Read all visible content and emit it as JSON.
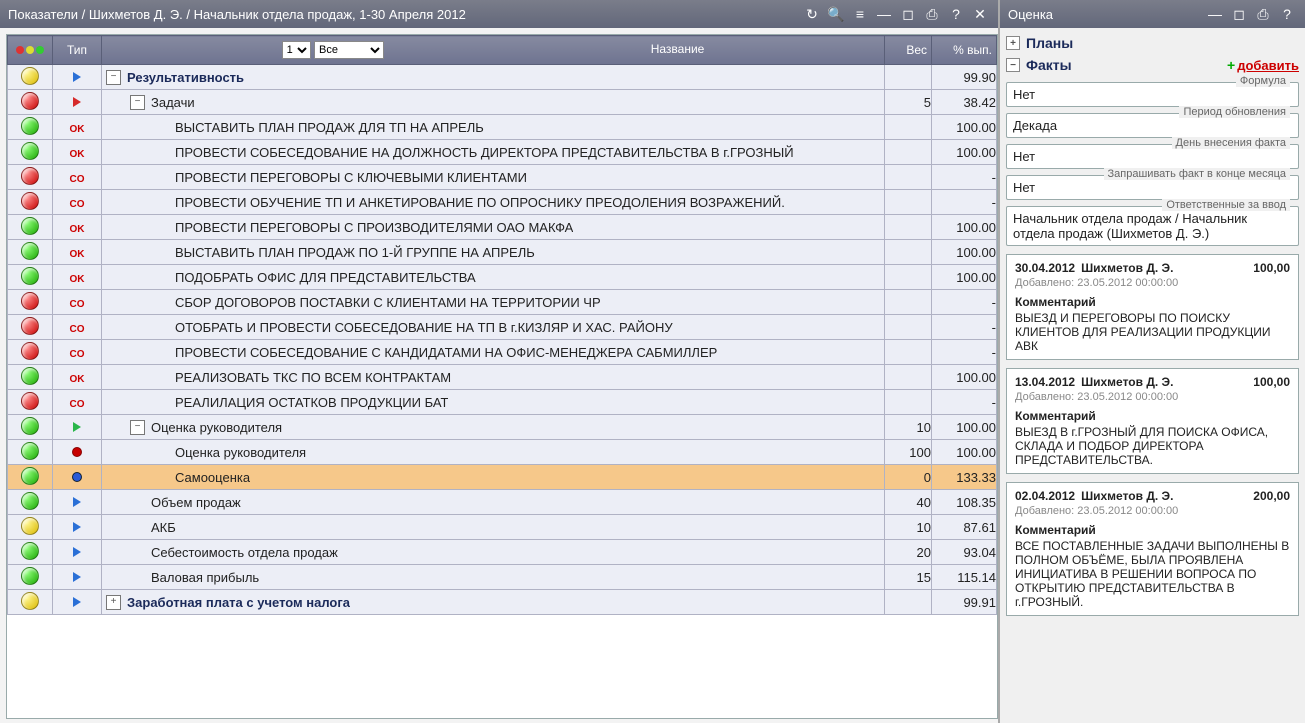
{
  "left": {
    "title": "Показатели / Шихметов Д. Э. / Начальник отдела продаж, 1-30 Апреля 2012",
    "select_level": "1",
    "select_filter": "Все",
    "cols": {
      "name": "Название",
      "type": "Тип",
      "weight": "Вес",
      "pct": "% вып."
    },
    "rows": [
      {
        "status": "yellow",
        "type": "tri-blue",
        "indent": 0,
        "tree": "-",
        "label": "Результативность",
        "bold": true,
        "weight": "",
        "pct": "99.90"
      },
      {
        "status": "red",
        "type": "tri-red",
        "indent": 1,
        "tree": "-",
        "label": "Задачи",
        "bold": false,
        "weight": "5",
        "pct": "38.42"
      },
      {
        "status": "green",
        "type": "OK",
        "indent": 2,
        "tree": "",
        "label": "ВЫСТАВИТЬ ПЛАН ПРОДАЖ ДЛЯ ТП НА АПРЕЛЬ",
        "bold": false,
        "weight": "",
        "pct": "100.00"
      },
      {
        "status": "green",
        "type": "OK",
        "indent": 2,
        "tree": "",
        "label": "ПРОВЕСТИ СОБЕСЕДОВАНИЕ НА ДОЛЖНОСТЬ ДИРЕКТОРА ПРЕДСТАВИТЕЛЬСТВА В г.ГРОЗНЫЙ",
        "bold": false,
        "weight": "",
        "pct": "100.00"
      },
      {
        "status": "red",
        "type": "CO",
        "indent": 2,
        "tree": "",
        "label": "ПРОВЕСТИ ПЕРЕГОВОРЫ С КЛЮЧЕВЫМИ КЛИЕНТАМИ",
        "bold": false,
        "weight": "",
        "pct": "-"
      },
      {
        "status": "red",
        "type": "CO",
        "indent": 2,
        "tree": "",
        "label": "ПРОВЕСТИ ОБУЧЕНИЕ ТП И АНКЕТИРОВАНИЕ ПО ОПРОСНИКУ ПРЕОДОЛЕНИЯ ВОЗРАЖЕНИЙ.",
        "bold": false,
        "weight": "",
        "pct": "-"
      },
      {
        "status": "green",
        "type": "OK",
        "indent": 2,
        "tree": "",
        "label": "ПРОВЕСТИ ПЕРЕГОВОРЫ С ПРОИЗВОДИТЕЛЯМИ ОАО МАКФА",
        "bold": false,
        "weight": "",
        "pct": "100.00"
      },
      {
        "status": "green",
        "type": "OK",
        "indent": 2,
        "tree": "",
        "label": "ВЫСТАВИТЬ ПЛАН ПРОДАЖ ПО 1-Й ГРУППЕ НА АПРЕЛЬ",
        "bold": false,
        "weight": "",
        "pct": "100.00"
      },
      {
        "status": "green",
        "type": "OK",
        "indent": 2,
        "tree": "",
        "label": "ПОДОБРАТЬ ОФИС ДЛЯ ПРЕДСТАВИТЕЛЬСТВА",
        "bold": false,
        "weight": "",
        "pct": "100.00"
      },
      {
        "status": "red",
        "type": "CO",
        "indent": 2,
        "tree": "",
        "label": "СБОР ДОГОВОРОВ ПОСТАВКИ С КЛИЕНТАМИ НА ТЕРРИТОРИИ ЧР",
        "bold": false,
        "weight": "",
        "pct": "-"
      },
      {
        "status": "red",
        "type": "CO",
        "indent": 2,
        "tree": "",
        "label": "ОТОБРАТЬ И ПРОВЕСТИ СОБЕСЕДОВАНИЕ НА ТП В г.КИЗЛЯР И ХАС. РАЙОНУ",
        "bold": false,
        "weight": "",
        "pct": "-"
      },
      {
        "status": "red",
        "type": "CO",
        "indent": 2,
        "tree": "",
        "label": "ПРОВЕСТИ СОБЕСЕДОВАНИЕ С КАНДИДАТАМИ НА ОФИС-МЕНЕДЖЕРА САБМИЛЛЕР",
        "bold": false,
        "weight": "",
        "pct": "-"
      },
      {
        "status": "green",
        "type": "OK",
        "indent": 2,
        "tree": "",
        "label": "РЕАЛИЗОВАТЬ ТКС ПО ВСЕМ КОНТРАКТАМ",
        "bold": false,
        "weight": "",
        "pct": "100.00"
      },
      {
        "status": "red",
        "type": "CO",
        "indent": 2,
        "tree": "",
        "label": "РЕАЛИЛАЦИЯ ОСТАТКОВ ПРОДУКЦИИ БАТ",
        "bold": false,
        "weight": "",
        "pct": "-"
      },
      {
        "status": "green",
        "type": "tri-green",
        "indent": 1,
        "tree": "-",
        "label": "Оценка руководителя",
        "bold": false,
        "weight": "10",
        "pct": "100.00"
      },
      {
        "status": "green",
        "type": "dot-red",
        "indent": 2,
        "tree": "",
        "label": "Оценка руководителя",
        "bold": false,
        "weight": "100",
        "pct": "100.00"
      },
      {
        "status": "green",
        "type": "dot-blue",
        "indent": 2,
        "tree": "",
        "label": "Самооценка",
        "bold": false,
        "weight": "0",
        "pct": "133.33",
        "selected": true
      },
      {
        "status": "green",
        "type": "tri-blue",
        "indent": 1,
        "tree": "",
        "label": "Объем продаж",
        "bold": false,
        "weight": "40",
        "pct": "108.35"
      },
      {
        "status": "yellow",
        "type": "tri-blue",
        "indent": 1,
        "tree": "",
        "label": "АКБ",
        "bold": false,
        "weight": "10",
        "pct": "87.61"
      },
      {
        "status": "green",
        "type": "tri-blue",
        "indent": 1,
        "tree": "",
        "label": "Себестоимость отдела продаж",
        "bold": false,
        "weight": "20",
        "pct": "93.04"
      },
      {
        "status": "green",
        "type": "tri-blue",
        "indent": 1,
        "tree": "",
        "label": "Валовая прибыль",
        "bold": false,
        "weight": "15",
        "pct": "115.14"
      },
      {
        "status": "yellow",
        "type": "tri-blue",
        "indent": 0,
        "tree": "+",
        "label": "Заработная плата с учетом налога",
        "bold": true,
        "weight": "",
        "pct": "99.91"
      }
    ]
  },
  "right": {
    "title": "Оценка",
    "plans_label": "Планы",
    "facts_label": "Факты",
    "add_label": "добавить",
    "fields": [
      {
        "legend": "Формула",
        "value": "Нет"
      },
      {
        "legend": "Период обновления",
        "value": "Декада"
      },
      {
        "legend": "День внесения факта",
        "value": "Нет"
      },
      {
        "legend": "Запрашивать факт в конце месяца",
        "value": "Нет"
      },
      {
        "legend": "Ответственные за ввод",
        "value": "Начальник отдела продаж / Начальник отдела продаж (Шихметов Д. Э.)"
      }
    ],
    "added_prefix": "Добавлено: ",
    "comment_label": "Комментарий",
    "entries": [
      {
        "date": "30.04.2012",
        "who": "Шихметов Д. Э.",
        "amount": "100,00",
        "added": "23.05.2012 00:00:00",
        "comment": "ВЫЕЗД И ПЕРЕГОВОРЫ ПО ПОИСКУ КЛИЕНТОВ ДЛЯ РЕАЛИЗАЦИИ ПРОДУКЦИИ АВК"
      },
      {
        "date": "13.04.2012",
        "who": "Шихметов Д. Э.",
        "amount": "100,00",
        "added": "23.05.2012 00:00:00",
        "comment": "ВЫЕЗД В г.ГРОЗНЫЙ ДЛЯ ПОИСКА ОФИСА, СКЛАДА И ПОДБОР ДИРЕКТОРА ПРЕДСТАВИТЕЛЬСТВА."
      },
      {
        "date": "02.04.2012",
        "who": "Шихметов Д. Э.",
        "amount": "200,00",
        "added": "23.05.2012 00:00:00",
        "comment": "ВСЕ ПОСТАВЛЕННЫЕ ЗАДАЧИ ВЫПОЛНЕНЫ В ПОЛНОМ ОБЪЁМЕ, БЫЛА ПРОЯВЛЕНА ИНИЦИАТИВА В РЕШЕНИИ ВОПРОСА ПО ОТКРЫТИЮ ПРЕДСТАВИТЕЛЬСТВА В г.ГРОЗНЫЙ."
      }
    ]
  }
}
